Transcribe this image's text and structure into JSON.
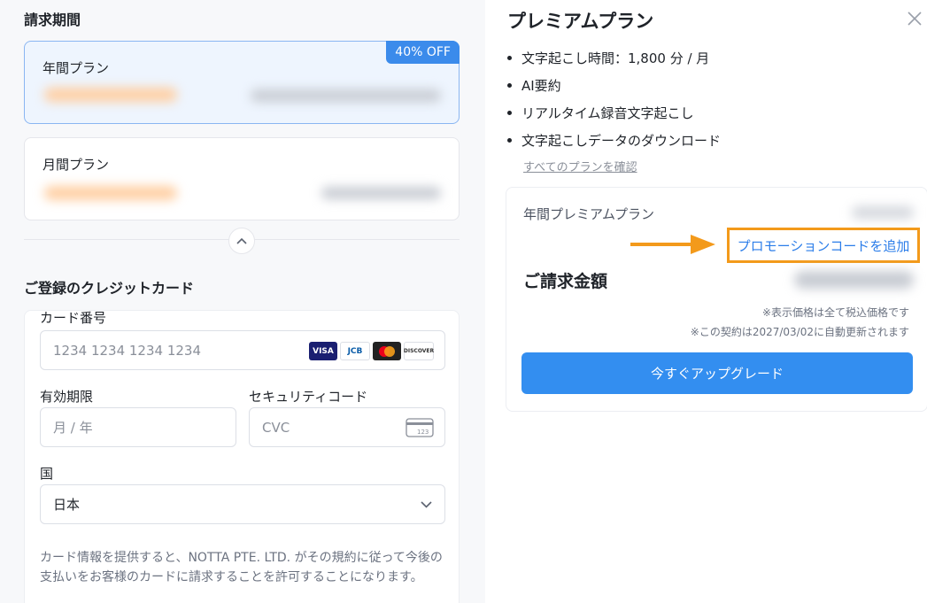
{
  "billing": {
    "section_title": "請求期間",
    "annual": {
      "name": "年間プラン",
      "badge": "40% OFF"
    },
    "monthly": {
      "name": "月間プラン"
    }
  },
  "card": {
    "section_title": "ご登録のクレジットカード",
    "number_label": "カード番号",
    "number_placeholder": "1234 1234 1234 1234",
    "expiry_label": "有効期限",
    "expiry_placeholder": "月 / 年",
    "cvc_label": "セキュリティコード",
    "cvc_placeholder": "CVC",
    "country_label": "国",
    "country_value": "日本",
    "brands": [
      "VISA",
      "JCB",
      "Mastercard",
      "DISCOVER"
    ],
    "terms": "カード情報を提供すると、NOTTA PTE. LTD. がその規約に従って今後の支払いをお客様のカードに請求することを許可することになります。"
  },
  "plan": {
    "title": "プレミアムプラン",
    "features": [
      "文字起こし時間：1,800 分 / 月",
      "AI要約",
      "リアルタイム録音文字起こし",
      "文字起こしデータのダウンロード"
    ],
    "view_all_link": "すべてのプランを確認"
  },
  "summary": {
    "plan_label": "年間プレミアムプラン",
    "promo_link": "プロモーションコードを追加",
    "total_label": "ご請求金額",
    "note_tax": "※表示価格は全て税込価格です",
    "note_renewal": "※この契約は2027/03/02に自動更新されます",
    "upgrade_button": "今すぐアップグレード"
  },
  "colors": {
    "accent": "#338ef0",
    "highlight": "#f39a1b",
    "badge": "#3b8beb"
  }
}
